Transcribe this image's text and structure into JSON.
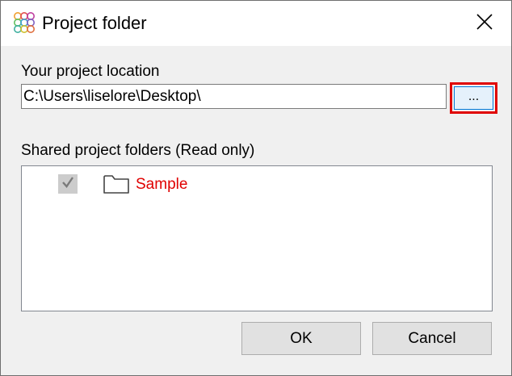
{
  "window": {
    "title": "Project folder",
    "app_icon": "rings-logo-icon",
    "close_icon": "close-icon"
  },
  "location": {
    "label": "Your project location",
    "path_value": "C:\\Users\\liselore\\Desktop\\",
    "browse_label": "...",
    "browse_highlight_color": "#e00000"
  },
  "shared": {
    "label": "Shared project folders (Read only)",
    "items": [
      {
        "name": "Sample",
        "checked": true,
        "enabled": false,
        "icon": "folder-icon",
        "name_color": "#e00000"
      }
    ]
  },
  "buttons": {
    "ok_label": "OK",
    "cancel_label": "Cancel"
  },
  "colors": {
    "accent": "#0078d7",
    "highlight": "#e00000",
    "dialog_bg": "#f0f0f0"
  }
}
